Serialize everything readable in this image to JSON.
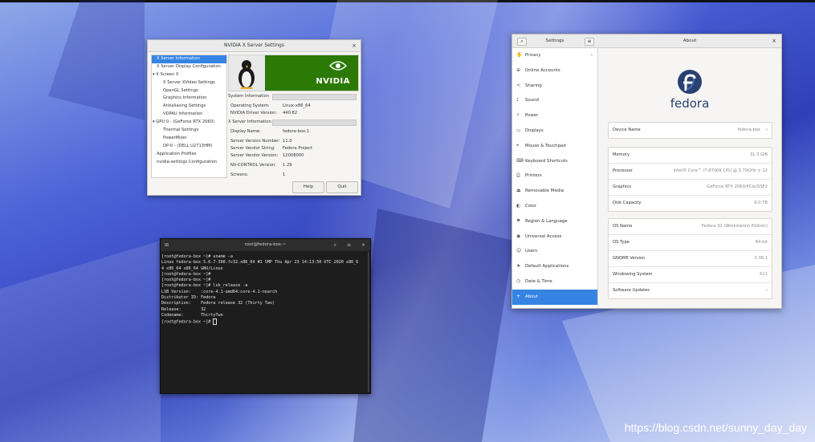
{
  "nvidia": {
    "title": "NVIDIA X Server Settings",
    "tree": [
      "X Server Information",
      "X Server Display Configuration",
      "▾ X Screen 0",
      "X Server XVideo Settings",
      "OpenGL Settings",
      "Graphics Information",
      "Antialiasing Settings",
      "VDPAU Information",
      "▾ GPU 0 - (GeForce RTX 2060)",
      "Thermal Settings",
      "PowerMizer",
      "DP-0 - (DELL U2713HM)",
      "Application Profiles",
      "nvidia-settings Configuration"
    ],
    "logo_text": "NVIDIA",
    "system_info_head": "System Information",
    "os_label": "Operating System:",
    "os_value": "Linux-x86_64",
    "driver_label": "NVIDIA Driver Version:",
    "driver_value": "440.82",
    "xserver_head": "X Server Information",
    "display_label": "Display Name:",
    "display_value": "fedora-box:1",
    "svn_label": "Server Version Number:",
    "svn_value": "11.0",
    "svs_label": "Server Vendor String:",
    "svs_value": "Fedora Project",
    "svv_label": "Server Vendor Version:",
    "svv_value": "12008000",
    "nvc_label": "NV-CONTROL Version:",
    "nvc_value": "1.29",
    "screens_label": "Screens:",
    "screens_value": "1",
    "help": "Help",
    "quit": "Quit",
    "close": "×"
  },
  "terminal": {
    "title": "root@fedora-box:~",
    "lines": [
      "[root@fedora-box ~]# uname -a",
      "Linux fedora-box 5.6.7-300.fc32.x86_64 #1 SMP Thu Apr 23 14:13:50 UTC 2020 x86_6",
      "4 x86_64 x86_64 GNU/Linux",
      "[root@fedora-box ~]#",
      "[root@fedora-box ~]#",
      "[root@fedora-box ~]# lsb_release -a",
      "LSB Version:    :core-4.1-amd64:core-4.1-noarch",
      "Distributor ID: Fedora",
      "Description:    Fedora release 32 (Thirty Two)",
      "Release:        32",
      "Codename:       ThirtyTwo"
    ],
    "prompt": "[root@fedora-box ~]# "
  },
  "settings": {
    "left_title": "Settings",
    "right_title": "About",
    "close": "×",
    "nav": [
      {
        "icon": "✋",
        "label": "Privacy",
        "chev": "›"
      },
      {
        "icon": "⊕",
        "label": "Online Accounts"
      },
      {
        "icon": "≺",
        "label": "Sharing"
      },
      {
        "icon": "♪",
        "label": "Sound"
      },
      {
        "icon": "⚡",
        "label": "Power"
      },
      {
        "icon": "▭",
        "label": "Displays"
      },
      {
        "icon": "⌖",
        "label": "Mouse & Touchpad"
      },
      {
        "icon": "⌨",
        "label": "Keyboard Shortcuts"
      },
      {
        "icon": "⎙",
        "label": "Printers"
      },
      {
        "icon": "⏏",
        "label": "Removable Media"
      },
      {
        "icon": "◐",
        "label": "Color"
      },
      {
        "icon": "⚑",
        "label": "Region & Language"
      },
      {
        "icon": "◉",
        "label": "Universal Access"
      },
      {
        "icon": "☺",
        "label": "Users"
      },
      {
        "icon": "★",
        "label": "Default Applications"
      },
      {
        "icon": "◷",
        "label": "Date & Time"
      },
      {
        "icon": "+",
        "label": "About"
      }
    ],
    "fedora_word": "fedora",
    "device_name_label": "Device Name",
    "device_name_value": "fedora-box",
    "memory_label": "Memory",
    "memory_value": "31.3 GiB",
    "processor_label": "Processor",
    "processor_value": "Intel® Core™ i7-8700K CPU @ 3.70GHz × 12",
    "graphics_label": "Graphics",
    "graphics_value": "GeForce RTX 2060/PCIe/SSE2",
    "disk_label": "Disk Capacity",
    "disk_value": "6.0 TB",
    "osname_label": "OS Name",
    "osname_value": "Fedora 32 (Workstation Edition)",
    "ostype_label": "OS Type",
    "ostype_value": "64-bit",
    "gnome_label": "GNOME Version",
    "gnome_value": "3.36.1",
    "ws_label": "Windowing System",
    "ws_value": "X11",
    "updates_label": "Software Updates"
  },
  "watermark": "https://blog.csdn.net/sunny_day_day",
  "colors": {
    "accent": "#3584e4",
    "nvidia_green": "#76b900",
    "fedora_blue": "#294172"
  }
}
